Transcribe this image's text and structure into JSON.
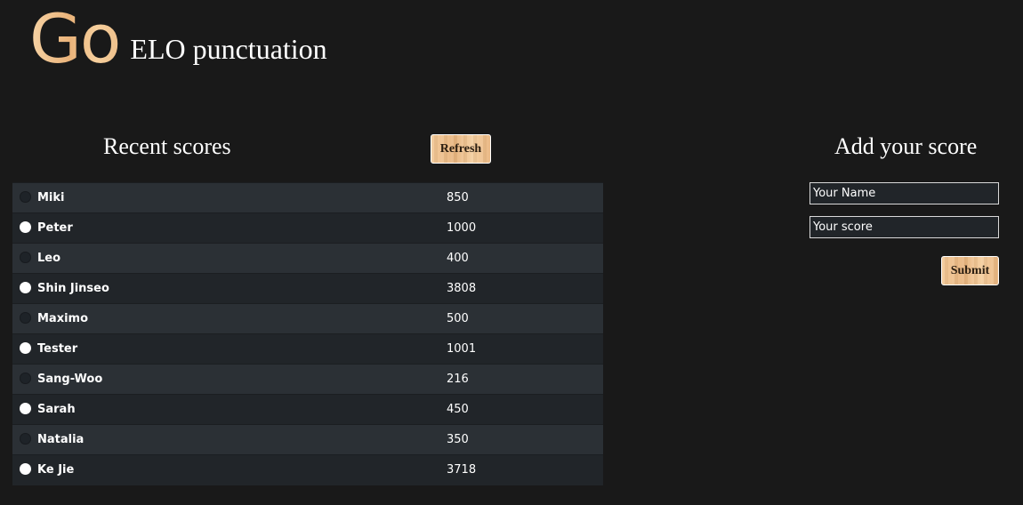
{
  "header": {
    "logo_text": "Go",
    "subtitle": "ELO punctuation"
  },
  "recent": {
    "title": "Recent scores",
    "refresh_label": "Refresh",
    "rows": [
      {
        "name": "Miki",
        "score": "850",
        "stone": "black"
      },
      {
        "name": "Peter",
        "score": "1000",
        "stone": "white"
      },
      {
        "name": "Leo",
        "score": "400",
        "stone": "black"
      },
      {
        "name": "Shin Jinseo",
        "score": "3808",
        "stone": "white"
      },
      {
        "name": "Maximo",
        "score": "500",
        "stone": "black"
      },
      {
        "name": "Tester",
        "score": "1001",
        "stone": "white"
      },
      {
        "name": "Sang-Woo",
        "score": "216",
        "stone": "black"
      },
      {
        "name": "Sarah",
        "score": "450",
        "stone": "white"
      },
      {
        "name": "Natalia",
        "score": "350",
        "stone": "black"
      },
      {
        "name": "Ke Jie",
        "score": "3718",
        "stone": "white"
      }
    ]
  },
  "add": {
    "title": "Add your score",
    "name_placeholder": "Your Name",
    "name_value": "",
    "score_placeholder": "Your score",
    "score_value": "",
    "submit_label": "Submit"
  },
  "colors": {
    "background": "#191919",
    "wood_accent": "#eab680",
    "row_odd": "#2b3035",
    "row_even": "#212529"
  }
}
